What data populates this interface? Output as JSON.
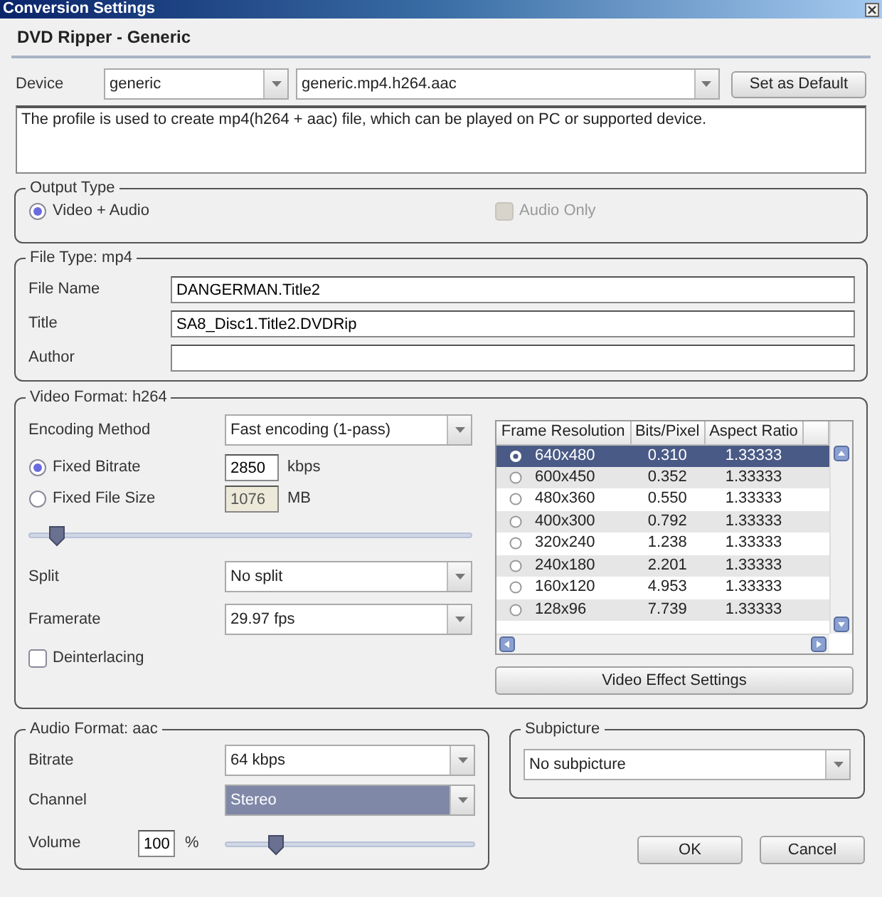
{
  "window": {
    "title": "Conversion Settings"
  },
  "header": "DVD Ripper - Generic",
  "device": {
    "label": "Device",
    "device_value": "generic",
    "profile_value": "generic.mp4.h264.aac",
    "default_button": "Set as Default"
  },
  "description": "The profile is used to create mp4(h264 + aac) file, which can be played on PC or supported device.",
  "output_type": {
    "legend": "Output Type",
    "options": [
      {
        "kind": "radio",
        "label": "Video + Audio",
        "checked": true,
        "disabled": false
      },
      {
        "kind": "checkbox",
        "label": "Audio Only",
        "checked": false,
        "disabled": true
      }
    ]
  },
  "file_type": {
    "legend": "File Type: mp4",
    "fields": [
      {
        "label": "File Name",
        "value": "DANGERMAN.Title2"
      },
      {
        "label": "Title",
        "value": "SA8_Disc1.Title2.DVDRip"
      },
      {
        "label": "Author"
      }
    ]
  },
  "video_format": {
    "legend": "Video Format: h264",
    "encoding": {
      "label": "Encoding Method",
      "value": "Fast encoding (1-pass)"
    },
    "rate_modes": [
      {
        "label": "Fixed Bitrate",
        "selected": true,
        "value": "2850",
        "unit": "kbps"
      },
      {
        "label": "Fixed File Size",
        "selected": false,
        "value": "1076",
        "unit": "MB"
      }
    ],
    "slider": {
      "level": 0.06
    },
    "split": {
      "label": "Split",
      "value": "No split"
    },
    "framerate": {
      "label": "Framerate",
      "value": "29.97 fps"
    },
    "deinterlacing": {
      "label": "Deinterlacing",
      "checked": false
    },
    "resolution_table": {
      "columns": [
        "Frame Resolution",
        "Bits/Pixel",
        "Aspect Ratio"
      ],
      "rows": [
        {
          "resolution": "640x480",
          "bits_per_pixel": "0.310",
          "aspect_ratio": "1.33333",
          "selected": true
        },
        {
          "resolution": "600x450",
          "bits_per_pixel": "0.352",
          "aspect_ratio": "1.33333",
          "selected": false
        },
        {
          "resolution": "480x360",
          "bits_per_pixel": "0.550",
          "aspect_ratio": "1.33333",
          "selected": false
        },
        {
          "resolution": "400x300",
          "bits_per_pixel": "0.792",
          "aspect_ratio": "1.33333",
          "selected": false
        },
        {
          "resolution": "320x240",
          "bits_per_pixel": "1.238",
          "aspect_ratio": "1.33333",
          "selected": false
        },
        {
          "resolution": "240x180",
          "bits_per_pixel": "2.201",
          "aspect_ratio": "1.33333",
          "selected": false
        },
        {
          "resolution": "160x120",
          "bits_per_pixel": "4.953",
          "aspect_ratio": "1.33333",
          "selected": false
        },
        {
          "resolution": "128x96",
          "bits_per_pixel": "7.739",
          "aspect_ratio": "1.33333",
          "selected": false
        }
      ]
    },
    "effect_button": "Video Effect Settings"
  },
  "audio_format": {
    "legend": "Audio Format: aac",
    "bitrate": {
      "label": "Bitrate",
      "value": "64 kbps"
    },
    "channel": {
      "label": "Channel",
      "value": "Stereo",
      "highlighted": true
    },
    "volume": {
      "label": "Volume",
      "value": "100",
      "unit": "%",
      "level": 0.2
    }
  },
  "subpicture": {
    "legend": "Subpicture",
    "value": "No subpicture"
  },
  "buttons": [
    "OK",
    "Cancel"
  ]
}
